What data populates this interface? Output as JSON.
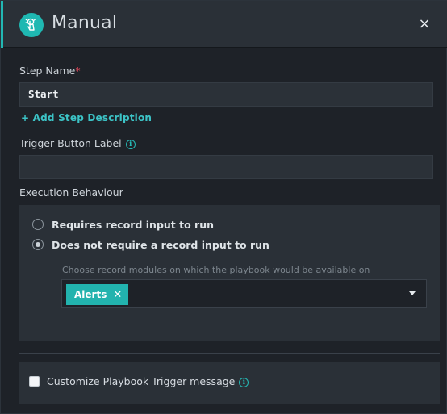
{
  "header": {
    "title": "Manual",
    "logo_icon": "manual-trigger-icon",
    "close_icon": "close-icon",
    "close_glyph": "×",
    "accent_color": "#22b7b3"
  },
  "step_name": {
    "label": "Step Name",
    "required_mark": "*",
    "value": "Start"
  },
  "add_description_link": "+ Add Step Description",
  "trigger_button_label": {
    "label": "Trigger Button Label",
    "value": "",
    "info_glyph": "i"
  },
  "execution_behaviour": {
    "label": "Execution Behaviour",
    "options": [
      {
        "label": "Requires record input to run",
        "selected": false
      },
      {
        "label": "Does not require a record input to run",
        "selected": true
      }
    ],
    "modules_hint": "Choose record modules on which the playbook would be available on",
    "selected_modules": [
      "Alerts"
    ],
    "remove_glyph": "✕"
  },
  "customize_message": {
    "label": "Customize Playbook Trigger message",
    "checked": false,
    "info_glyph": "i"
  }
}
